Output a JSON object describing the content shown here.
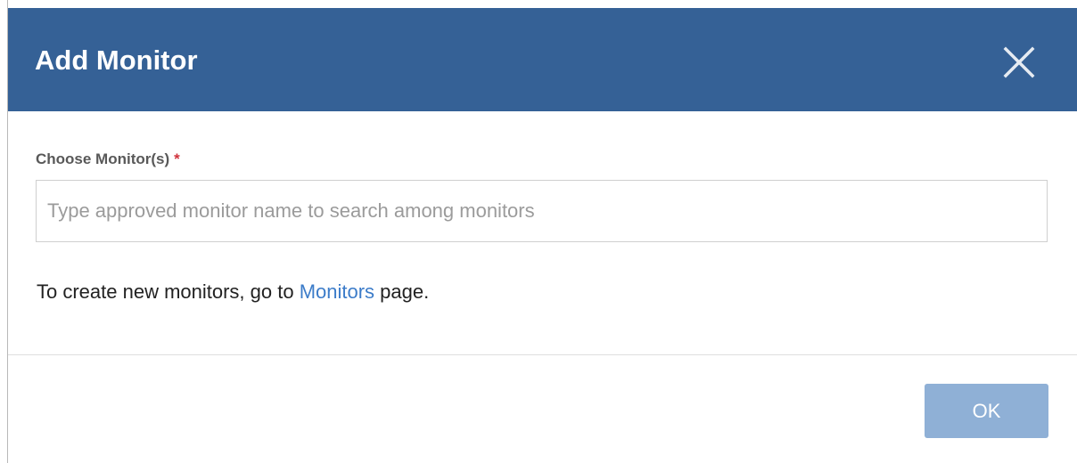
{
  "dialog": {
    "title": "Add Monitor",
    "close_icon": "close-icon",
    "field": {
      "label": "Choose Monitor(s)",
      "required_marker": "*",
      "value": "",
      "placeholder": "Type approved monitor name to search among monitors"
    },
    "help": {
      "prefix": "To create new monitors, go to ",
      "link_text": "Monitors",
      "suffix": " page."
    },
    "ok_label": "OK"
  },
  "colors": {
    "header_bg": "#356196",
    "link": "#3c7cc9",
    "required": "#d0323c",
    "ok_button_bg": "#8fb0d6"
  }
}
